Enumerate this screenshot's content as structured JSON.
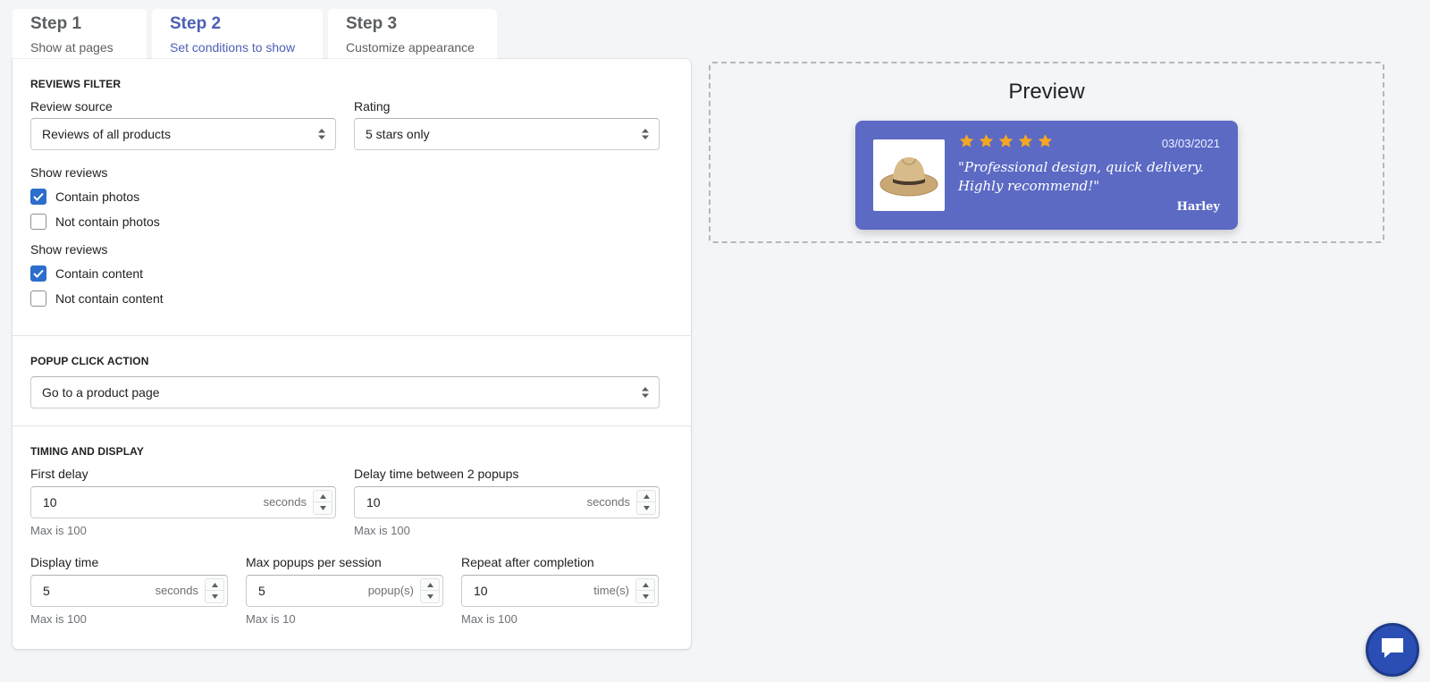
{
  "tabs": [
    {
      "title": "Step 1",
      "subtitle": "Show at pages"
    },
    {
      "title": "Step 2",
      "subtitle": "Set conditions to show"
    },
    {
      "title": "Step 3",
      "subtitle": "Customize appearance"
    }
  ],
  "reviews_filter": {
    "title": "REVIEWS FILTER",
    "review_source": {
      "label": "Review source",
      "value": "Reviews of all products"
    },
    "rating": {
      "label": "Rating",
      "value": "5 stars only"
    },
    "photos_group": {
      "label": "Show reviews",
      "options": [
        {
          "label": "Contain photos",
          "checked": true
        },
        {
          "label": "Not contain photos",
          "checked": false
        }
      ]
    },
    "content_group": {
      "label": "Show reviews",
      "options": [
        {
          "label": "Contain content",
          "checked": true
        },
        {
          "label": "Not contain content",
          "checked": false
        }
      ]
    }
  },
  "popup_click_action": {
    "title": "POPUP CLICK ACTION",
    "value": "Go to a product page"
  },
  "timing": {
    "title": "TIMING AND DISPLAY",
    "first_delay": {
      "label": "First delay",
      "value": "10",
      "suffix": "seconds",
      "help": "Max is 100"
    },
    "between_delay": {
      "label": "Delay time between 2 popups",
      "value": "10",
      "suffix": "seconds",
      "help": "Max is 100"
    },
    "display_time": {
      "label": "Display time",
      "value": "5",
      "suffix": "seconds",
      "help": "Max is 100"
    },
    "max_popups": {
      "label": "Max popups per session",
      "value": "5",
      "suffix": "popup(s)",
      "help": "Max is 10"
    },
    "repeat": {
      "label": "Repeat after completion",
      "value": "10",
      "suffix": "time(s)",
      "help": "Max is 100"
    }
  },
  "preview": {
    "title": "Preview",
    "popup": {
      "rating": 5,
      "date": "03/03/2021",
      "text": "\"Professional design, quick delivery. Highly recommend!\"",
      "author": "Harley",
      "background": "#5c6ac4",
      "star_color": "#f5a623",
      "image_icon": "straw-hat-icon"
    }
  },
  "colors": {
    "accent": "#4d5fb5",
    "checkbox": "#2c6ecb",
    "chat": "#2b4eb5"
  },
  "icons": {
    "select_arrows": "select-arrows-icon",
    "checkmark": "checkmark-icon",
    "chat": "chat-bubble-icon"
  }
}
